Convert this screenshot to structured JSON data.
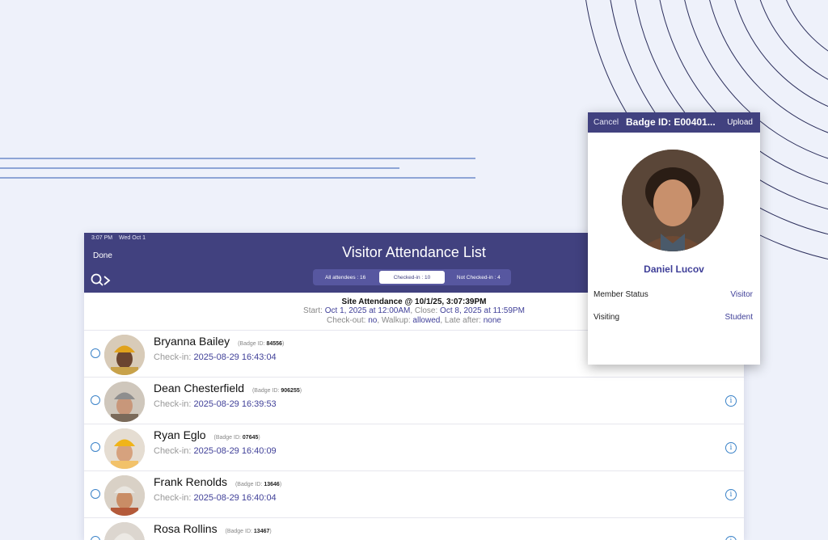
{
  "header": {
    "time": "3:07 PM",
    "date": "Wed Oct 1",
    "done_label": "Done",
    "title": "Visitor Attendance List",
    "search_icon": "search-chevron-icon"
  },
  "segments": [
    {
      "label": "All attendees : 16",
      "active": false
    },
    {
      "label": "Checked-in : 10",
      "active": true
    },
    {
      "label": "Not Checked-in : 4",
      "active": false
    }
  ],
  "summary": {
    "title": "Site Attendance  @ 10/1/25, 3:07:39PM",
    "start_label": "Start:",
    "start_value": "Oct 1, 2025 at 12:00AM",
    "close_label": ", Close:",
    "close_value": "Oct 8, 2025 at 11:59PM",
    "checkout_label": "Check-out:",
    "checkout_value": "no",
    "walkup_label": ", Walkup:",
    "walkup_value": "allowed",
    "lateafter_label": ", Late after:",
    "lateafter_value": "none"
  },
  "attendees": [
    {
      "name": "Bryanna Bailey",
      "badge_label": "(Badge ID:",
      "badge_id": "84556",
      "badge_close": ")",
      "checkin_label": "Check-in:",
      "checkin": "2025-08-29 16:43:04"
    },
    {
      "name": "Dean Chesterfield",
      "badge_label": "(Badge ID:",
      "badge_id": "906255",
      "badge_close": ")",
      "checkin_label": "Check-in:",
      "checkin": "2025-08-29 16:39:53"
    },
    {
      "name": "Ryan Eglo",
      "badge_label": "(Badge ID:",
      "badge_id": "07645",
      "badge_close": ")",
      "checkin_label": "Check-in:",
      "checkin": "2025-08-29 16:40:09"
    },
    {
      "name": "Frank Renolds",
      "badge_label": "(Badge ID:",
      "badge_id": "13646",
      "badge_close": ")",
      "checkin_label": "Check-in:",
      "checkin": "2025-08-29 16:40:04"
    },
    {
      "name": "Rosa Rollins",
      "badge_label": "(Badge ID:",
      "badge_id": "13467",
      "badge_close": ")",
      "checkin_label": "Check-in:",
      "checkin": ""
    }
  ],
  "popup": {
    "cancel_label": "Cancel",
    "title": "Badge ID: E00401...",
    "upload_label": "Upload",
    "name": "Daniel Lucov",
    "fields": [
      {
        "label": "Member Status",
        "value": "Visitor"
      },
      {
        "label": "Visiting",
        "value": "Student"
      }
    ]
  },
  "colors": {
    "header_bg": "#41417f",
    "accent": "#3f3f98",
    "link_blue": "#3a82c8",
    "page_bg": "#eef1fa"
  }
}
